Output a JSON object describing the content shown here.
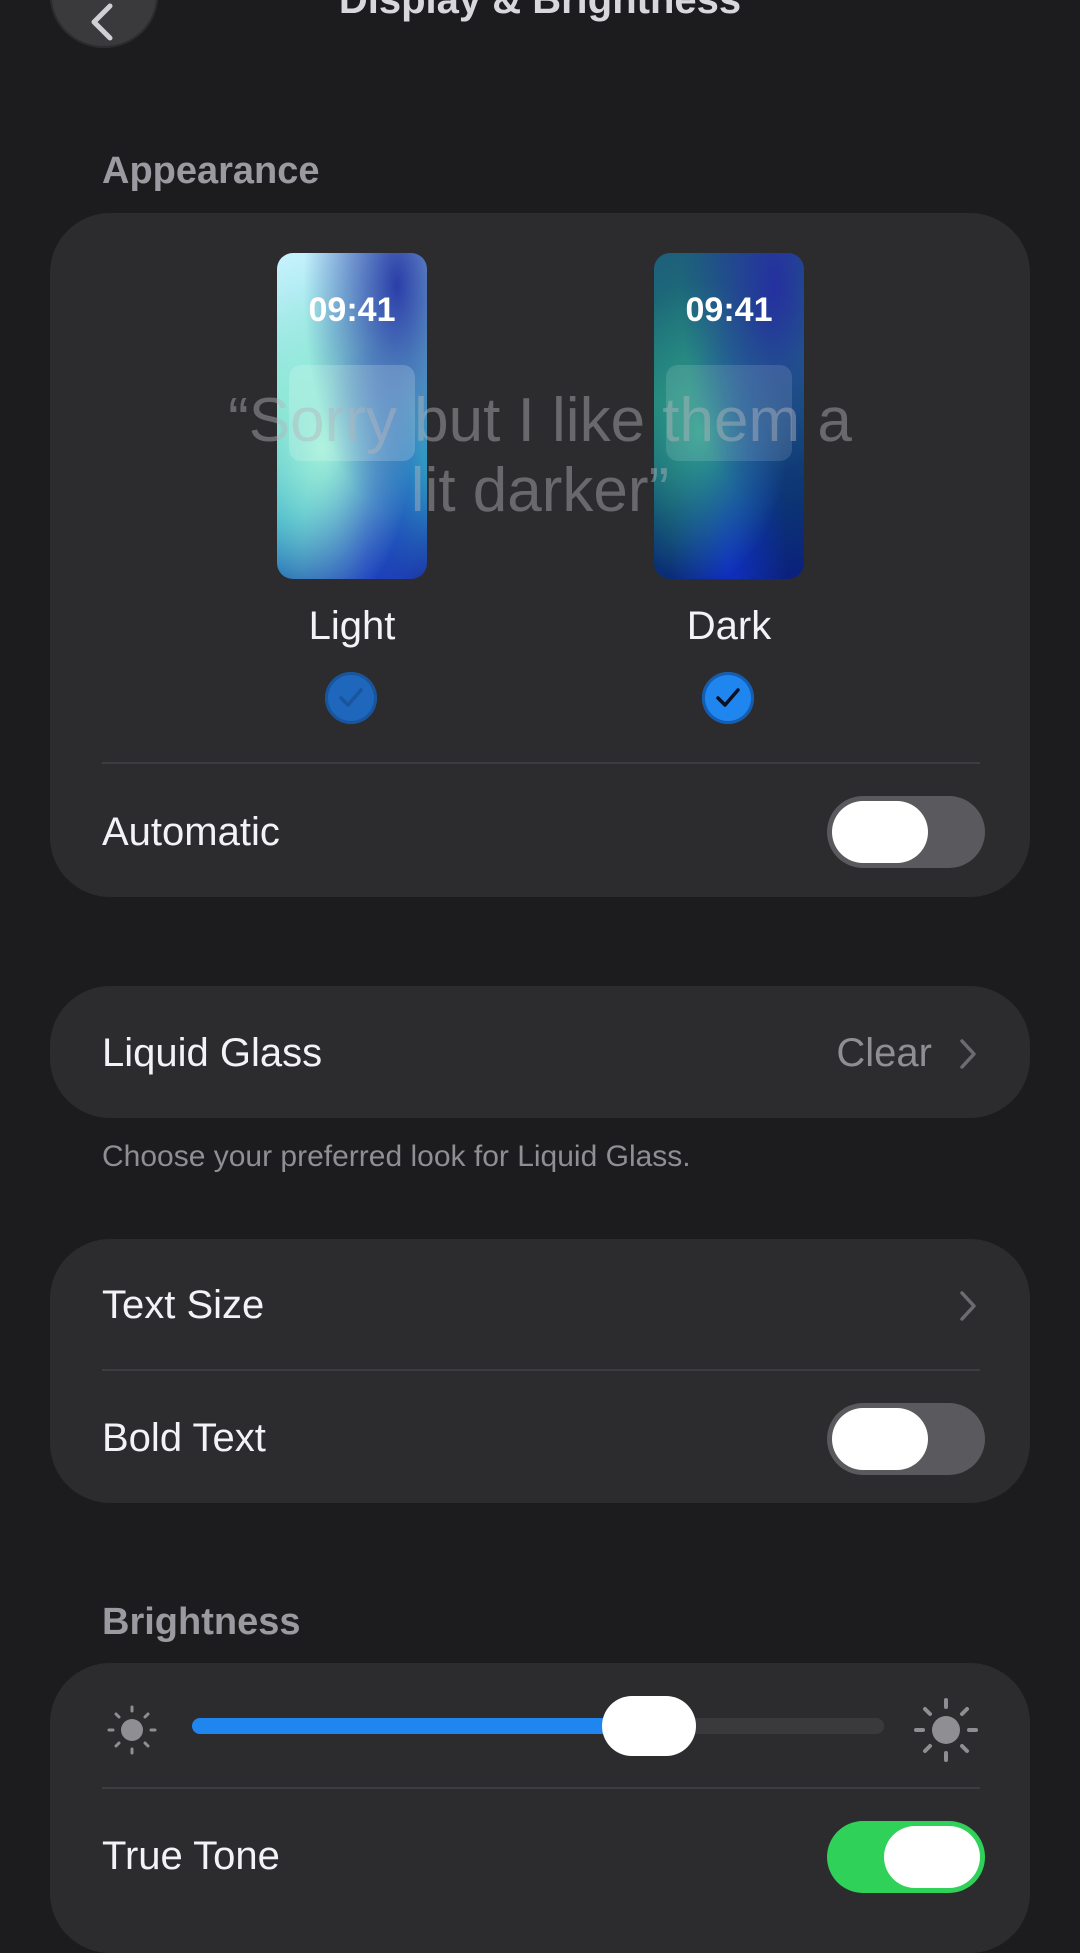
{
  "nav": {
    "title": "Display & Brightness"
  },
  "appearance": {
    "header": "Appearance",
    "options": [
      {
        "label": "Light",
        "time": "09:41",
        "selected": true
      },
      {
        "label": "Dark",
        "time": "09:41",
        "selected": true
      }
    ],
    "automatic_label": "Automatic",
    "automatic_on": false
  },
  "overlay": {
    "caption_line1": "“Sorry but I like them a",
    "caption_line2": "lit darker”"
  },
  "liquid_glass": {
    "label": "Liquid Glass",
    "value": "Clear",
    "footnote": "Choose your preferred look for Liquid Glass."
  },
  "text": {
    "text_size_label": "Text Size",
    "bold_text_label": "Bold Text",
    "bold_text_on": false
  },
  "brightness": {
    "header": "Brightness",
    "level": 0.66,
    "true_tone_label": "True Tone",
    "true_tone_on": true
  },
  "colors": {
    "accent": "#1f86f0",
    "toggle_on": "#30d158",
    "toggle_off": "#5a5a5e",
    "card": "#2c2c2e",
    "background": "#1c1c1e"
  },
  "icons": {
    "back": "chevron-left-icon",
    "disclosure": "chevron-right-icon",
    "brightness_low": "sun-small-icon",
    "brightness_high": "sun-large-icon",
    "selected": "checkmark-icon"
  }
}
